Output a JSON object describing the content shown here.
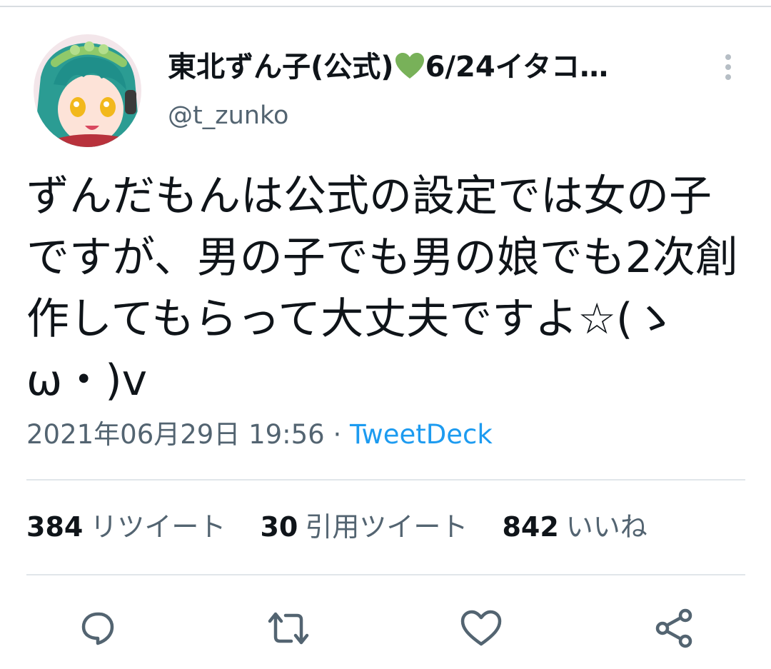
{
  "tweet": {
    "author": {
      "name": "東北ずん子(公式)",
      "name_emoji": "💚",
      "name_suffix": "6/24イタコ…",
      "handle": "@t_zunko",
      "avatar_icon": "avatar-image"
    },
    "text": "ずんだもんは公式の設定では女の子ですが、男の子でも男の娘でも2次創作してもらって大丈夫ですよ☆(ゝω・)v",
    "date": "2021年06月29日 19:56",
    "separator": "·",
    "source": "TweetDeck",
    "stats": {
      "retweets": {
        "count": "384",
        "label": "リツイート"
      },
      "quotes": {
        "count": "30",
        "label": "引用ツイート"
      },
      "likes": {
        "count": "842",
        "label": "いいね"
      }
    }
  },
  "icons": {
    "more": "more-vertical-icon",
    "reply": "reply-icon",
    "retweet": "retweet-icon",
    "like": "heart-icon",
    "share": "share-icon"
  },
  "colors": {
    "text": "#0f1419",
    "secondary": "#536471",
    "link": "#1d9bf0",
    "heart": "#78b159",
    "icon": "#536471",
    "divider": "#e1e6ea"
  }
}
